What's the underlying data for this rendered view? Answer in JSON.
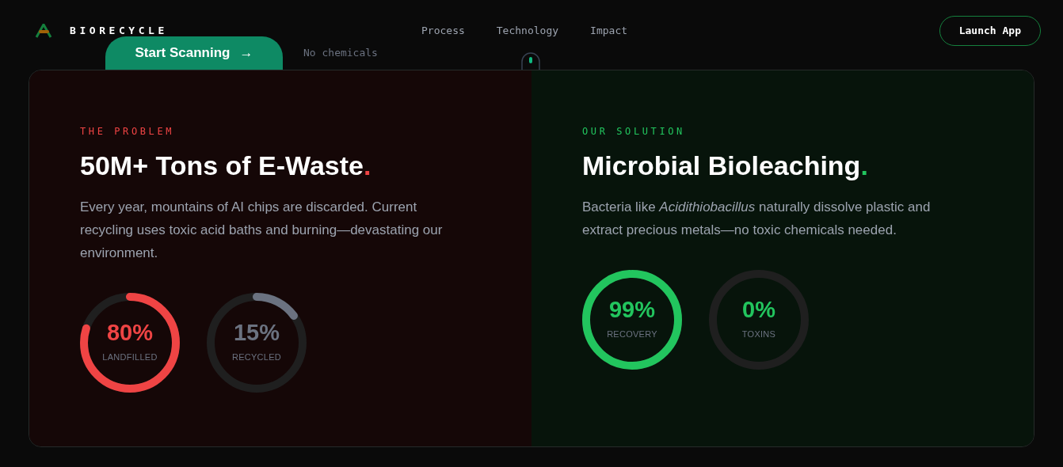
{
  "brand": {
    "name": "BIORECYCLE"
  },
  "nav": [
    {
      "label": "Process"
    },
    {
      "label": "Technology"
    },
    {
      "label": "Impact"
    }
  ],
  "launch_button": "Launch App",
  "hero": {
    "cta": "Start Scanning",
    "cta_arrow": "→",
    "tagline": "No chemicals"
  },
  "panels": [
    {
      "kind": "problem",
      "eyebrow": "THE PROBLEM",
      "title": "50M+ Tons of E-Waste",
      "title_dot": ".",
      "body": "Every year, mountains of AI chips are discarded. Current recycling uses toxic acid baths and burning—devastating our environment.",
      "rings": [
        {
          "value": "80%",
          "label": "LANDFILLED",
          "level": 0.8,
          "color": "#ef4444"
        },
        {
          "value": "15%",
          "label": "RECYCLED",
          "level": 0.15,
          "color": "#6b7280"
        }
      ]
    },
    {
      "kind": "solution",
      "eyebrow": "OUR SOLUTION",
      "title": "Microbial Bioleaching",
      "title_dot": ".",
      "body": "Bacteria like *Acidithiobacillus* naturally dissolve plastic and extract precious metals—no toxic chemicals needed.",
      "rings": [
        {
          "value": "99%",
          "label": "RECOVERY",
          "level": 0.99,
          "color": "#22c55e"
        },
        {
          "value": "0%",
          "label": "TOXINS",
          "level": 0,
          "color": "#22c55e"
        }
      ]
    }
  ]
}
